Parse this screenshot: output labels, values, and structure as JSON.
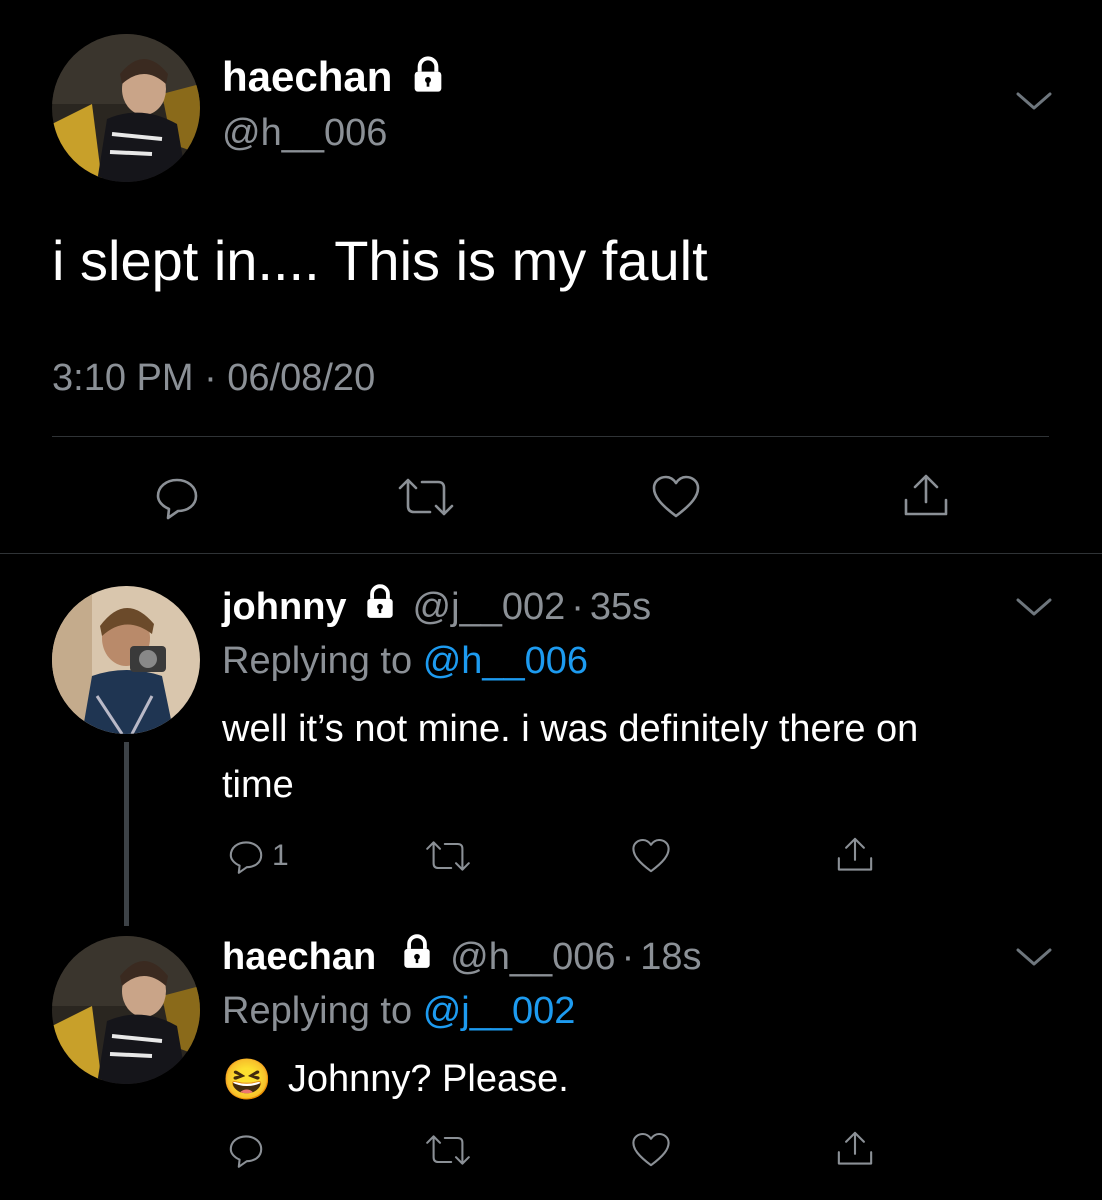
{
  "main_tweet": {
    "display_name": "haechan",
    "handle": "@h__006",
    "text": "i slept in.... This is my fault",
    "timestamp": "3:10 PM · 06/08/20"
  },
  "replies": [
    {
      "display_name": "johnny",
      "handle": "@j__002",
      "time": "35s",
      "replying_prefix": "Replying to",
      "replying_handle": "@h__006",
      "text_line1": "well it’s not mine. i was definitely there on",
      "text_line2": "time",
      "reply_count": "1"
    },
    {
      "display_name": "haechan",
      "handle": "@h__006",
      "time": "18s",
      "replying_prefix": "Replying to",
      "replying_handle": "@j__002",
      "emoji": "😆",
      "text": "Johnny? Please."
    }
  ],
  "separator": "·",
  "icons": {
    "lock": "lock-icon",
    "chevron": "chevron-down-icon",
    "reply": "reply-icon",
    "retweet": "retweet-icon",
    "like": "heart-icon",
    "share": "share-icon"
  },
  "colors": {
    "background": "#000000",
    "link": "#1d9bf0",
    "muted": "#8b9096",
    "divider": "#2f3336"
  }
}
